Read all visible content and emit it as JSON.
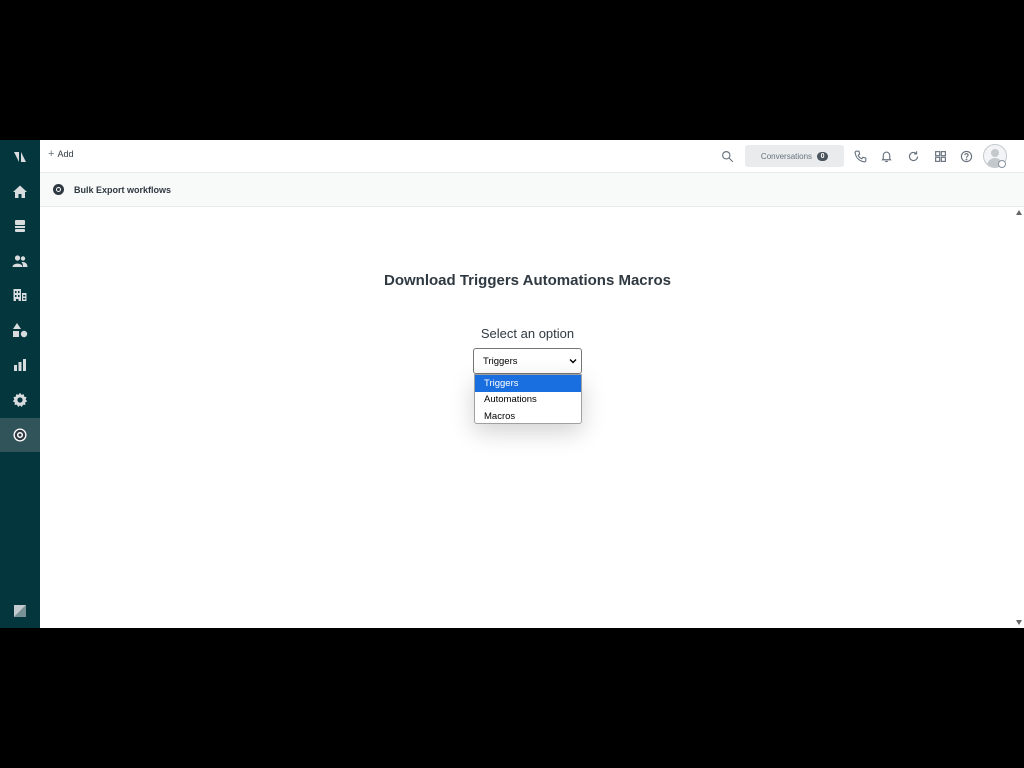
{
  "sidebar": {
    "items": [
      {
        "icon": "zendesk-products-icon"
      },
      {
        "icon": "home-icon"
      },
      {
        "icon": "views-icon"
      },
      {
        "icon": "customers-icon"
      },
      {
        "icon": "organizations-icon"
      },
      {
        "icon": "objects-icon"
      },
      {
        "icon": "reporting-icon"
      },
      {
        "icon": "admin-gear-icon"
      },
      {
        "icon": "bulk-export-app-icon",
        "active": true
      }
    ],
    "footer_icon": "zendesk-logo-icon"
  },
  "topbar": {
    "add_label": "Add",
    "conversations_label": "Conversations",
    "conversations_count": "0",
    "icons": [
      "search-icon",
      "phone-icon",
      "notifications-icon",
      "refresh-icon",
      "apps-grid-icon",
      "help-icon",
      "avatar"
    ]
  },
  "appbar": {
    "title": "Bulk Export workflows"
  },
  "main": {
    "heading": "Download Triggers Automations Macros",
    "select_label": "Select an option",
    "selected_value": "Triggers",
    "options": [
      "Triggers",
      "Automations",
      "Macros"
    ]
  },
  "colors": {
    "sidebar_bg": "#03363d",
    "sidebar_active": "#30545a",
    "dropdown_highlight": "#1a6fe0",
    "text_dark": "#2f3941"
  }
}
